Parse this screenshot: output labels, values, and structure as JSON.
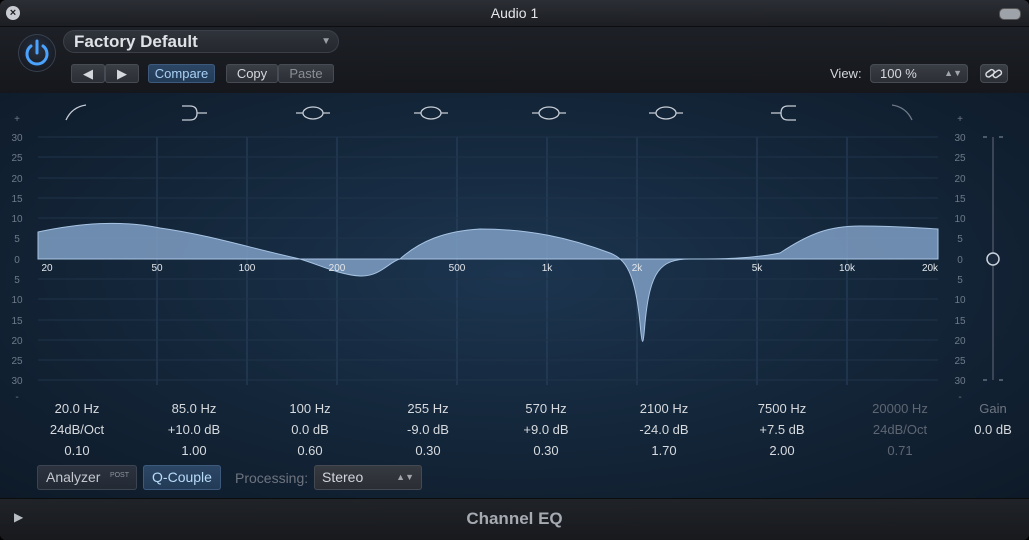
{
  "window": {
    "title": "Audio 1"
  },
  "header": {
    "preset": "Factory Default",
    "compare": "Compare",
    "copy": "Copy",
    "paste": "Paste",
    "view_label": "View:",
    "view_value": "100 %"
  },
  "freq_labels": [
    "20",
    "50",
    "100",
    "200",
    "500",
    "1k",
    "2k",
    "5k",
    "10k",
    "20k"
  ],
  "db_labels_left": [
    "+",
    "30",
    "25",
    "20",
    "15",
    "10",
    "5",
    "0",
    "5",
    "10",
    "15",
    "20",
    "25",
    "30",
    "-"
  ],
  "bands": [
    {
      "freq": "20.0 Hz",
      "gain": "24dB/Oct",
      "q": "0.10",
      "enabled": true
    },
    {
      "freq": "85.0 Hz",
      "gain": "+10.0 dB",
      "q": "1.00",
      "enabled": true
    },
    {
      "freq": "100 Hz",
      "gain": "0.0 dB",
      "q": "0.60",
      "enabled": true
    },
    {
      "freq": "255 Hz",
      "gain": "-9.0 dB",
      "q": "0.30",
      "enabled": true
    },
    {
      "freq": "570 Hz",
      "gain": "+9.0 dB",
      "q": "0.30",
      "enabled": true
    },
    {
      "freq": "2100 Hz",
      "gain": "-24.0 dB",
      "q": "1.70",
      "enabled": true
    },
    {
      "freq": "7500 Hz",
      "gain": "+7.5 dB",
      "q": "2.00",
      "enabled": true
    },
    {
      "freq": "20000 Hz",
      "gain": "24dB/Oct",
      "q": "0.71",
      "enabled": false
    }
  ],
  "gain": {
    "label": "Gain",
    "value": "0.0 dB"
  },
  "footer": {
    "analyzer": "Analyzer",
    "post": "POST",
    "qcouple": "Q-Couple",
    "processing_label": "Processing:",
    "processing_value": "Stereo",
    "plugin_name": "Channel EQ"
  },
  "colors": {
    "accent": "#4aa3ff",
    "curve_fill": "#7f9fc4"
  }
}
